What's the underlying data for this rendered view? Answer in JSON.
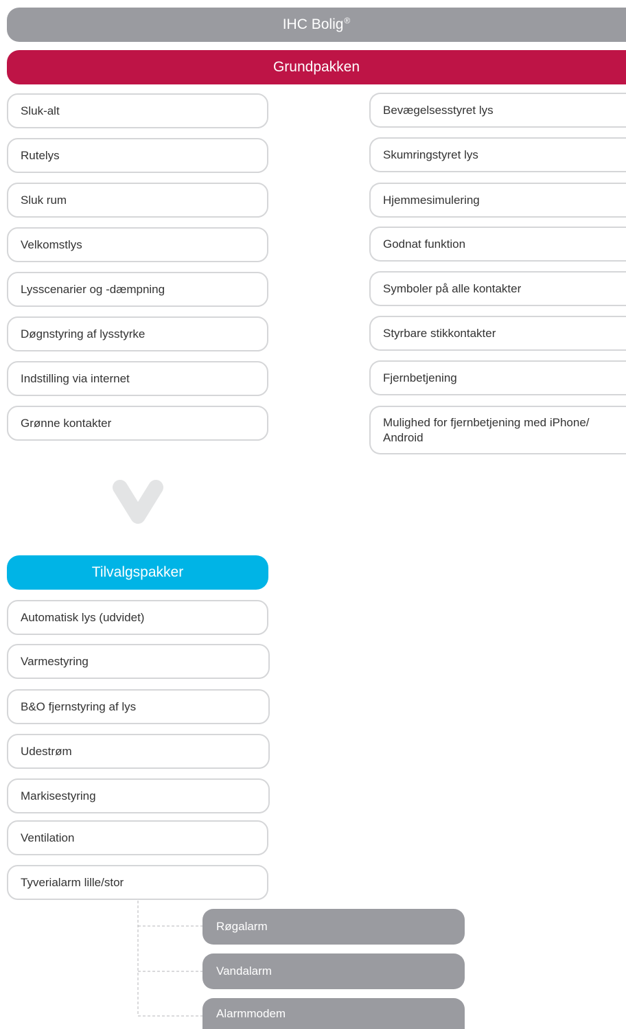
{
  "header": {
    "title": "IHC Bolig",
    "title_mark": "®"
  },
  "grundpakken": {
    "title": "Grundpakken",
    "left_items": [
      "Sluk-alt",
      "Rutelys",
      "Sluk rum",
      "Velkomstlys",
      "Lysscenarier og -dæmpning",
      "Døgnstyring af lysstyrke",
      "Indstilling via internet",
      "Grønne kontakter"
    ],
    "right_items": [
      "Bevægelsesstyret lys",
      "Skumringstyret lys",
      "Hjemmesimulering",
      "Godnat funktion",
      "Symboler på alle kontakter",
      "Styrbare stikkontakter",
      "Fjernbetjening",
      "Mulighed for fjernbetjening med iPhone/ Android"
    ]
  },
  "tilvalgspakker": {
    "title": "Tilvalgspakker",
    "items": [
      "Automatisk lys (udvidet)",
      "Varmestyring",
      "B&O fjernstyring af lys",
      "Udestrøm",
      "Markisestyring",
      "Ventilation",
      "Tyverialarm lille/stor"
    ],
    "sub_items": [
      "Røgalarm",
      "Vandalarm",
      "Alarmmodem"
    ]
  },
  "colors": {
    "header": "#9a9ba0",
    "grundpakken": "#be1446",
    "tilvalgspakker": "#00b4e6",
    "item_border": "#d5d6d8",
    "chevron": "#e3e4e5"
  },
  "icons": {
    "arrow": "chevron-down-icon"
  }
}
